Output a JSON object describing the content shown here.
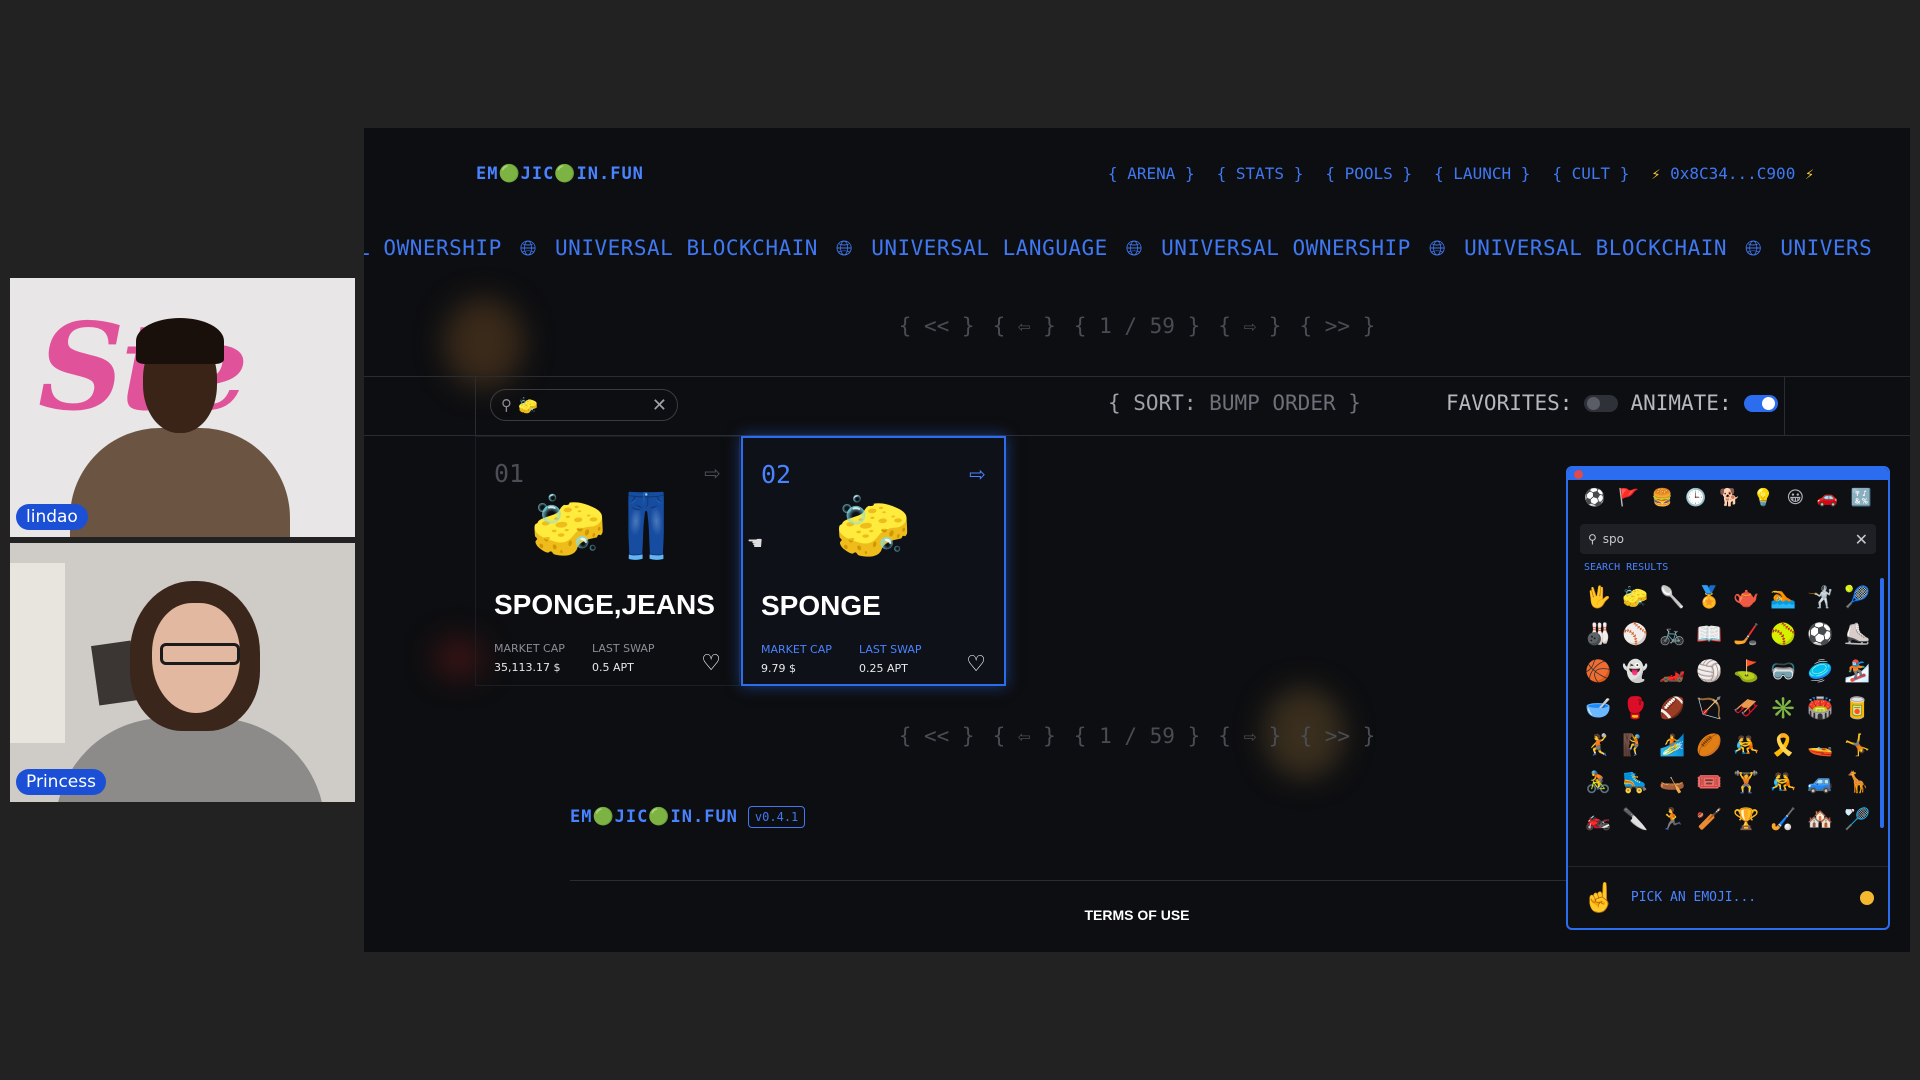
{
  "participants": [
    {
      "name": "lindao",
      "background_text": "Ste",
      "background_text_2": "c"
    },
    {
      "name": "Princess"
    }
  ],
  "app": {
    "brand": "EM🟢JIC🟢IN.FUN",
    "nav": [
      "{ ARENA }",
      "{ STATS }",
      "{ POOLS }",
      "{ LAUNCH }",
      "{ CULT }"
    ],
    "wallet": "0x8C34...C900",
    "marquee": [
      "AL OWNERSHIP",
      "UNIVERSAL BLOCKCHAIN",
      "UNIVERSAL LANGUAGE",
      "UNIVERSAL OWNERSHIP",
      "UNIVERSAL BLOCKCHAIN",
      "UNIVERS"
    ],
    "pager": {
      "first": "{ << }",
      "prev": "{ ⇦ }",
      "page": "{ 1 / 59 }",
      "next": "{ ⇨ }",
      "last": "{ >> }"
    },
    "search": {
      "value": "🧽"
    },
    "sort": {
      "label": "{ SORT:",
      "value": "BUMP ORDER }"
    },
    "favorites_label": "FAVORITES:",
    "favorites_on": false,
    "animate_label": "ANIMATE:",
    "animate_on": true,
    "cards": [
      {
        "rank": "01",
        "emojis": "🧽👖",
        "name": "SPONGE,JEANS",
        "market_cap_label": "MARKET CAP",
        "market_cap": "35,113.17 $",
        "last_swap_label": "LAST SWAP",
        "last_swap": "0.5 APT"
      },
      {
        "rank": "02",
        "emojis": "🧽",
        "name": "SPONGE",
        "market_cap_label": "MARKET CAP",
        "market_cap": "9.79 $",
        "last_swap_label": "LAST SWAP",
        "last_swap": "0.25 APT"
      }
    ],
    "footer": {
      "brand": "EM🟢JIC🟢IN.FUN",
      "version": "v0.4.1",
      "terms": "TERMS OF USE"
    }
  },
  "picker": {
    "search_value": "spo",
    "results_label": "SEARCH RESULTS",
    "categories": [
      "⚽",
      "🚩",
      "🍔",
      "🕒",
      "🐕",
      "💡",
      "😀",
      "🚗",
      "🔣"
    ],
    "emojis": [
      "🖖",
      "🧽",
      "🥄",
      "🏅",
      "🫖",
      "🏊",
      "🤺",
      "🎾",
      "🎳",
      "⚾",
      "🚲",
      "📖",
      "🏒",
      "🥎",
      "⚽",
      "⛸️",
      "🏀",
      "👻",
      "🏎️",
      "🏐",
      "⛳",
      "🥽",
      "🥏",
      "🏂",
      "🥣",
      "🥊",
      "🏈",
      "🏹",
      "🛷",
      "✳️",
      "🏟️",
      "🥫",
      "🤾",
      "🧗",
      "🏄",
      "🏉",
      "🤼",
      "🎗️",
      "🚤",
      "🤸",
      "🚴",
      "🛼",
      "🛶",
      "🎟️",
      "🏋️",
      "🤼",
      "🚙",
      "🦒",
      "🏍️",
      "🔪",
      "🏃",
      "🏏",
      "🏆",
      "🏑",
      "🏘️",
      "🏸"
    ],
    "placeholder": "PICK AN EMOJI...",
    "pick_hand": "☝️"
  },
  "colors": {
    "accent": "#2c6df0",
    "brand": "#4a83ff",
    "bolt": "#f2c43a",
    "tone": "#f4b830"
  }
}
